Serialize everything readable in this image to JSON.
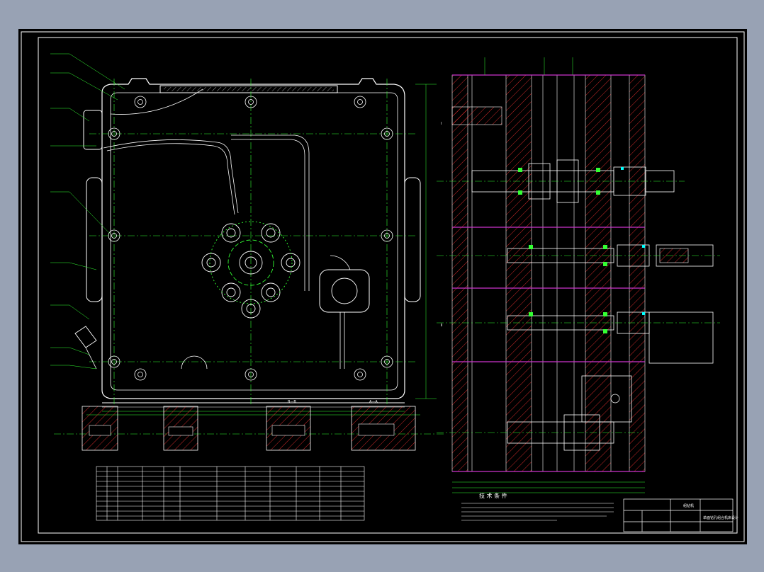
{
  "colors": {
    "frame_background": "#98a2b4",
    "sheet_background": "#000000",
    "outline": "#ffffff",
    "centerline": "#33ff33",
    "dimension": "#33ff33",
    "hatch": "#ff3333",
    "section_boundary": "#cc33cc",
    "annotation": "#00ffff"
  },
  "views": {
    "section_bb": "B—B",
    "section_aa": "A—A",
    "section_left": "Ⅰ",
    "section_right": "Ⅱ"
  },
  "tech_requirements": {
    "title": "技 术 条 件"
  },
  "title_block": {
    "company": "组钻机",
    "drawing_title": "单面钻孔组合机床设计"
  },
  "icons": {
    "gear": "gear-icon",
    "bolt": "bolt-icon"
  }
}
